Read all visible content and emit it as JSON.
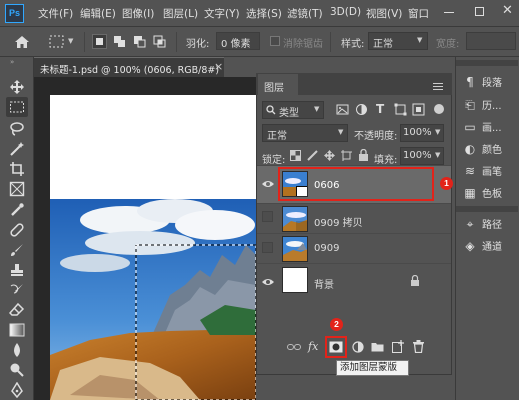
{
  "app": {
    "logo": "Ps"
  },
  "menu": [
    {
      "label": "文件(F)"
    },
    {
      "label": "编辑(E)"
    },
    {
      "label": "图像(I)"
    },
    {
      "label": "图层(L)"
    },
    {
      "label": "文字(Y)"
    },
    {
      "label": "选择(S)"
    },
    {
      "label": "滤镜(T)"
    },
    {
      "label": "3D(D)"
    },
    {
      "label": "视图(V)"
    },
    {
      "label": "窗口"
    }
  ],
  "options_bar": {
    "feather_label": "羽化:",
    "feather_value": "0 像素",
    "antialias_label": "消除锯齿",
    "style_label": "样式:",
    "style_value": "正常",
    "width_label": "宽度:"
  },
  "document": {
    "tab_title": "未标题-1.psd @ 100% (0606, RGB/8#)",
    "tab_close": "×"
  },
  "layers_panel": {
    "tab_label": "图层",
    "filter_kind": "类型",
    "blend_mode": "正常",
    "opacity_label": "不透明度:",
    "opacity_value": "100%",
    "lock_label": "锁定:",
    "fill_label": "填充:",
    "fill_value": "100%",
    "layers": [
      {
        "name": "0606",
        "visible": true,
        "selected": true
      },
      {
        "name": "0909 拷贝",
        "visible": false,
        "selected": false
      },
      {
        "name": "0909",
        "visible": false,
        "selected": false
      },
      {
        "name": "背景",
        "visible": true,
        "selected": false,
        "locked": true
      }
    ],
    "footer_fx": "fx",
    "add_mask_tooltip": "添加图层蒙版"
  },
  "right_dock": [
    {
      "label": "段落",
      "icon": "paragraph-icon"
    },
    {
      "label": "历...",
      "icon": "history-icon"
    },
    {
      "label": "画...",
      "icon": "artboard-icon"
    },
    {
      "label": "颜色",
      "icon": "color-icon"
    },
    {
      "label": "画笔",
      "icon": "brush-settings-icon"
    },
    {
      "label": "色板",
      "icon": "swatches-icon"
    },
    {
      "label": "路径",
      "icon": "paths-icon"
    },
    {
      "label": "通道",
      "icon": "channels-icon"
    }
  ],
  "annotations": {
    "badge1": "1",
    "badge2": "2"
  },
  "colors": {
    "highlight": "#e2231a",
    "panel": "#535353",
    "dark": "#3c3c3c",
    "accent": "#31a8ff"
  }
}
